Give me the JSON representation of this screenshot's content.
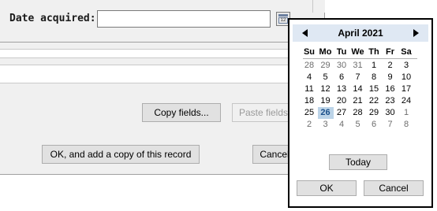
{
  "record_form": {
    "date_label": "Date acquired:",
    "date_value": "",
    "calendar_icon_text": "12",
    "copy_fields_label": "Copy fields...",
    "paste_fields_label": "Paste fields",
    "ok_add_copy_label": "OK, and add a copy of this record",
    "cancel_label": "Cancel"
  },
  "calendar": {
    "month_title": "April 2021",
    "weekdays": [
      "Su",
      "Mo",
      "Tu",
      "We",
      "Th",
      "Fr",
      "Sa"
    ],
    "weeks": [
      [
        "28",
        "29",
        "30",
        "31",
        "1",
        "2",
        "3"
      ],
      [
        "4",
        "5",
        "6",
        "7",
        "8",
        "9",
        "10"
      ],
      [
        "11",
        "12",
        "13",
        "14",
        "15",
        "16",
        "17"
      ],
      [
        "18",
        "19",
        "20",
        "21",
        "22",
        "23",
        "24"
      ],
      [
        "25",
        "26",
        "27",
        "28",
        "29",
        "30",
        "1"
      ],
      [
        "2",
        "3",
        "4",
        "5",
        "6",
        "7",
        "8"
      ]
    ],
    "other_month_flags": [
      [
        true,
        true,
        true,
        true,
        false,
        false,
        false
      ],
      [
        false,
        false,
        false,
        false,
        false,
        false,
        false
      ],
      [
        false,
        false,
        false,
        false,
        false,
        false,
        false
      ],
      [
        false,
        false,
        false,
        false,
        false,
        false,
        false
      ],
      [
        false,
        false,
        false,
        false,
        false,
        false,
        true
      ],
      [
        true,
        true,
        true,
        true,
        true,
        true,
        true
      ]
    ],
    "selected_day": "26",
    "today_label": "Today",
    "ok_label": "OK",
    "cancel_label": "Cancel"
  },
  "colors": {
    "header_bar": "#dfe8f3",
    "selected_day_bg": "#bcd4e8",
    "other_month_text": "#6d6d6d"
  }
}
